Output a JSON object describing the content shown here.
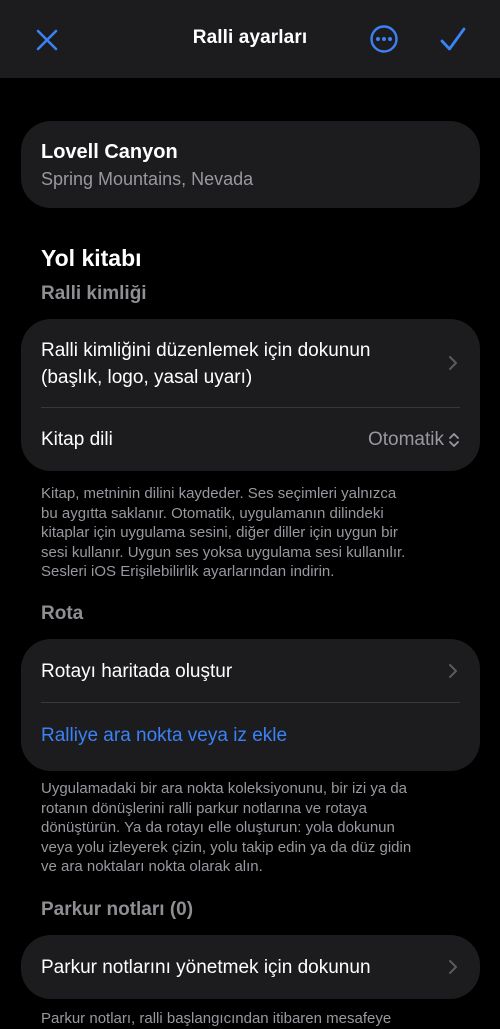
{
  "navbar": {
    "title": "Ralli ayarları",
    "close_icon": "xmark-icon",
    "more_icon": "ellipsis-circle-icon",
    "done_icon": "checkmark-icon",
    "accent_color": "#3b82f6"
  },
  "location": {
    "name": "Lovell Canyon",
    "subtitle": "Spring Mountains, Nevada"
  },
  "roadbook": {
    "title": "Yol kitabı",
    "identity_header": "Ralli kimliği",
    "edit_identity_line1": "Ralli kimliğini düzenlemek için dokunun",
    "edit_identity_line2": "(başlık, logo, yasal uyarı)",
    "language_label": "Kitap dili",
    "language_value": "Otomatik",
    "language_note_lines": [
      "Kitap, metninin dilini kaydeder. Ses seçimleri yalnızca",
      "bu aygıtta saklanır. Otomatik, uygulamanın dilindeki",
      "kitaplar için uygulama sesini, diğer diller için uygun bir",
      "sesi kullanır. Uygun ses yoksa uygulama sesi kullanılır.",
      "Sesleri iOS Erişilebilirlik ayarlarından indirin."
    ]
  },
  "route": {
    "header": "Rota",
    "create_on_map": "Rotayı haritada oluştur",
    "add_waypoint": "Ralliye ara nokta veya iz ekle",
    "note_lines": [
      "Uygulamadaki bir ara nokta koleksiyonunu, bir izi ya da",
      "rotanın dönüşlerini ralli parkur notlarına ve rotaya",
      "dönüştürün. Ya da rotayı elle oluşturun: yola dokunun",
      "veya yolu izleyerek çizin, yolu takip edin ya da düz gidin",
      "ve ara noktaları nokta olarak alın."
    ]
  },
  "pace_notes": {
    "header": "Parkur notları (0)",
    "manage": "Parkur notlarını yönetmek için dokunun",
    "footer_partial": "Parkur notları, ralli başlangıcından itibaren mesafeye"
  }
}
